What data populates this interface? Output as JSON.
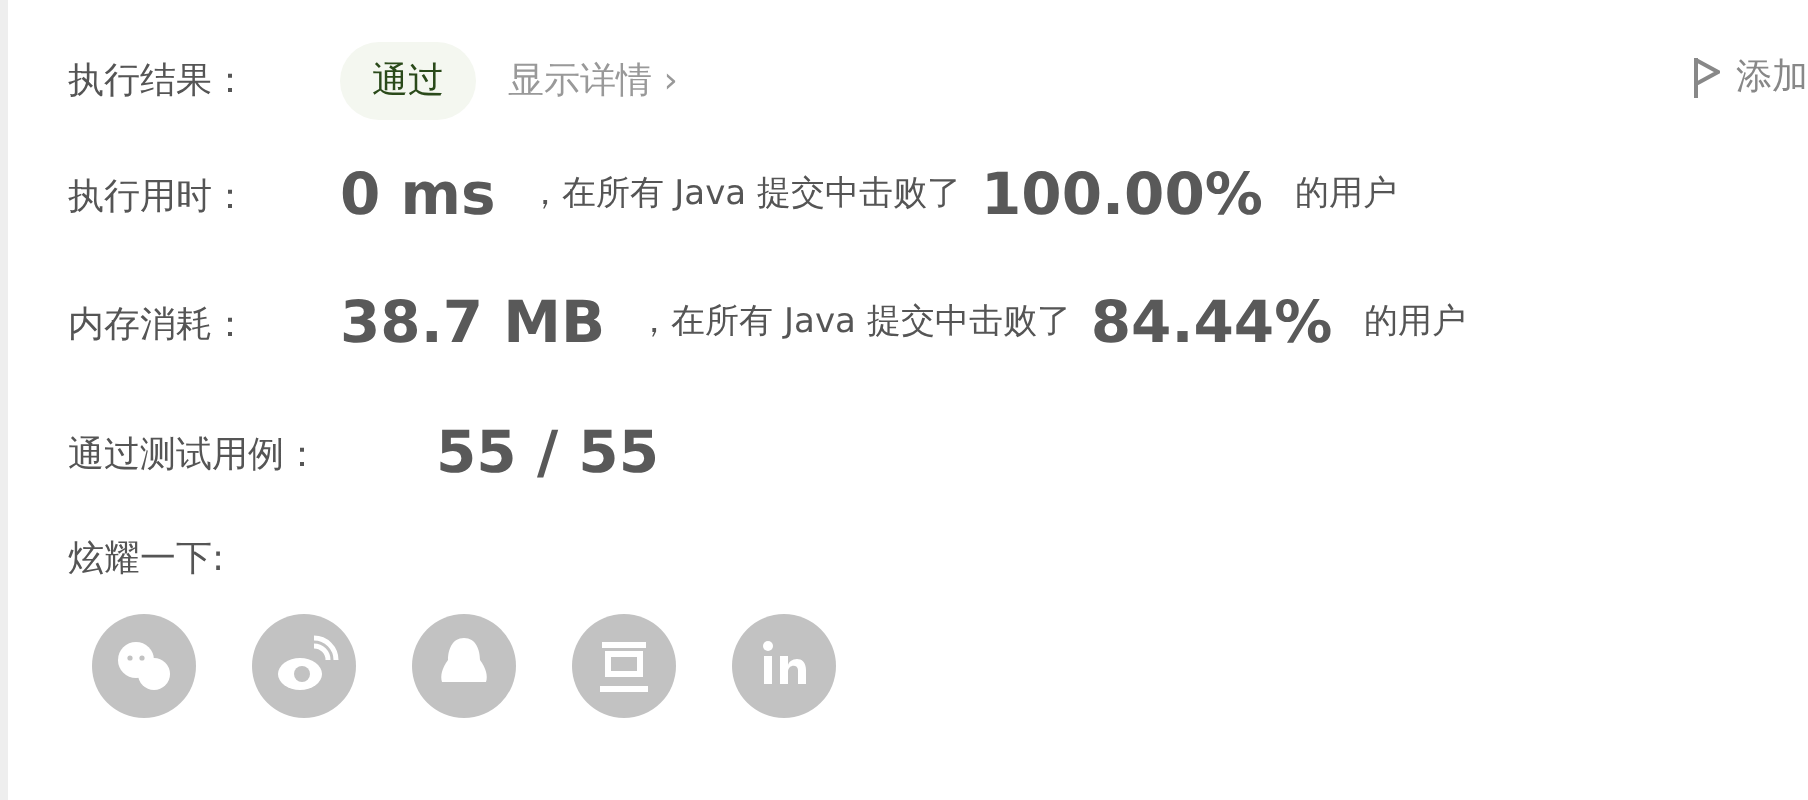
{
  "result": {
    "label": "执行结果：",
    "status": "通过",
    "details_link": "显示详情",
    "details_arrow": "›",
    "add_note": "添加"
  },
  "stats": [
    {
      "label": "执行用时：",
      "value": "0 ms",
      "middle": "，在所有 Java 提交中击败了",
      "percent": "100.00%",
      "suffix": "的用户"
    },
    {
      "label": "内存消耗：",
      "value": "38.7 MB",
      "middle": "，在所有 Java 提交中击败了",
      "percent": "84.44%",
      "suffix": "的用户"
    }
  ],
  "testcases": {
    "label": "通过测试用例：",
    "value": "55 / 55"
  },
  "share": {
    "label": "炫耀一下:",
    "buttons": [
      {
        "kind": "chat"
      },
      {
        "kind": "weibo"
      },
      {
        "kind": "penguin"
      },
      {
        "kind": "bean"
      },
      {
        "kind": "linkedin"
      }
    ]
  }
}
